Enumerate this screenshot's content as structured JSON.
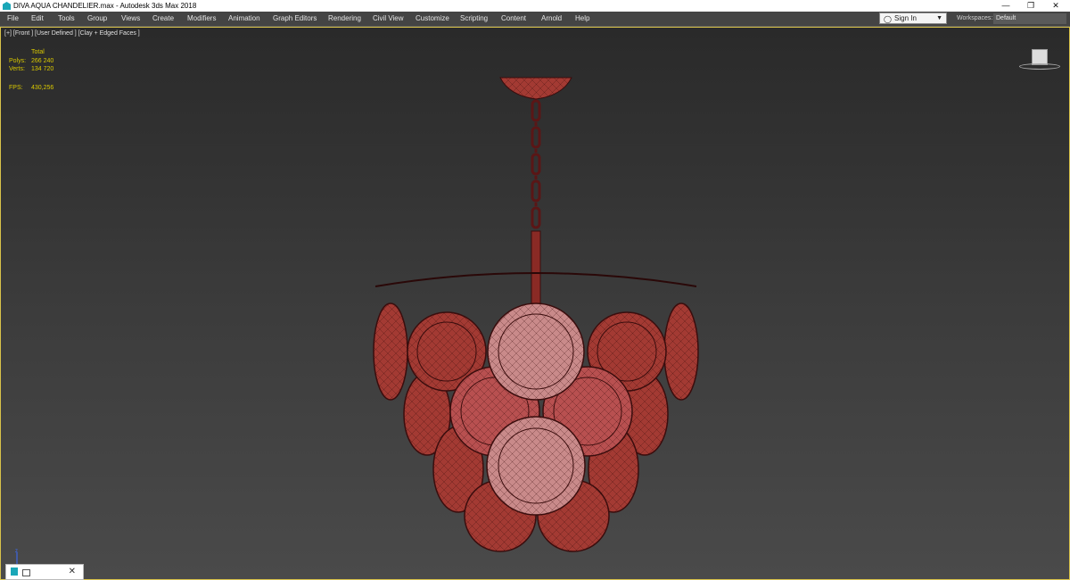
{
  "window": {
    "title": "DIVA AQUA CHANDELIER.max - Autodesk 3ds Max 2018",
    "minimize_glyph": "—",
    "restore_glyph": "❐",
    "close_glyph": "✕"
  },
  "menu": {
    "items": [
      "File",
      "Edit",
      "Tools",
      "Group",
      "Views",
      "Create",
      "Modifiers",
      "Animation",
      "Graph Editors",
      "Rendering",
      "Civil View",
      "Customize",
      "Scripting",
      "Content",
      "Arnold",
      "Help"
    ]
  },
  "account": {
    "sign_in": "Sign In",
    "workspaces_label": "Workspaces:",
    "workspace_value": "Default"
  },
  "viewport": {
    "label": "[+] [Front ] [User Defined ] [Clay + Edged Faces ]",
    "stats": {
      "header": "Total",
      "polys_label": "Polys:",
      "polys_value": "266 240",
      "verts_label": "Verts:",
      "verts_value": "134 720",
      "fps_label": "FPS:",
      "fps_value": "430,256"
    },
    "axis_label": "z"
  },
  "taskbar": {
    "close_glyph": "✕"
  },
  "colors": {
    "model_fill": "#a33a33",
    "model_fill_light": "#c98a8a",
    "model_wire": "#3a0d0d",
    "stats_text": "#d9c800",
    "viewport_border": "#d8c24a"
  },
  "icons": {
    "app": "3ds-max-icon",
    "user": "user-icon",
    "dropdown": "chevron-down-icon",
    "viewcube": "viewcube-icon",
    "axis": "axis-tripod-icon"
  }
}
